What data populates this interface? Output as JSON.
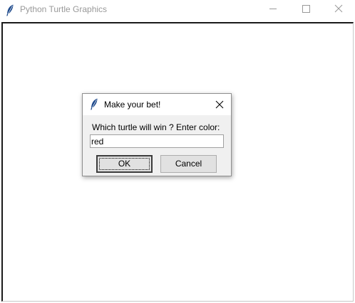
{
  "window": {
    "title": "Python Turtle Graphics",
    "icon": "feather-icon",
    "controls": [
      "minimize-icon",
      "maximize-icon",
      "close-icon"
    ]
  },
  "dialog": {
    "title": "Make your bet!",
    "icon": "feather-icon",
    "prompt": "Which turtle will win ? Enter color:",
    "input_value": "red",
    "ok_label": "OK",
    "cancel_label": "Cancel"
  },
  "colors": {
    "accent_icon": "#1e4a8c",
    "title_inactive": "#999999",
    "dialog_bg": "#f0f0f0",
    "button_bg": "#e1e1e1"
  }
}
